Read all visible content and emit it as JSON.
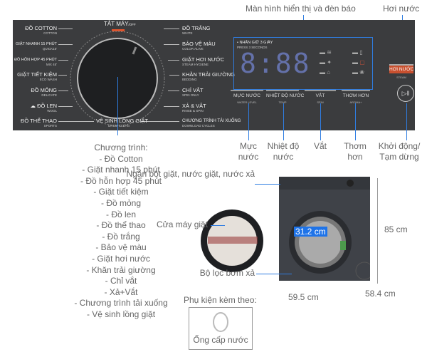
{
  "top_labels": {
    "display": "Màn hình hiển thị và đèn báo",
    "steam": "Hơi nước"
  },
  "panel": {
    "off": "TẮT MÁY",
    "off_en": "/OFF",
    "left_programs": [
      {
        "vi": "ĐỒ COTTON",
        "en": "COTTON"
      },
      {
        "vi": "GIẶT NHANH 15 PHÚT",
        "en": "QUICK15'"
      },
      {
        "vi": "ĐỒ HỖN HỢP 45 PHÚT",
        "en": "MIX 45'"
      },
      {
        "vi": "GIẶT TIẾT KIỆM",
        "en": "ECO WASH"
      },
      {
        "vi": "ĐỒ MỎNG",
        "en": "DELICATE"
      },
      {
        "vi": "ĐỒ LEN",
        "en": "WOOL"
      },
      {
        "vi": "ĐỒ THỂ THAO",
        "en": "SPORTS"
      }
    ],
    "right_programs": [
      {
        "vi": "ĐỒ TRẮNG",
        "en": "WHITE"
      },
      {
        "vi": "BẢO VỆ MÀU",
        "en": "COLOR ALIVE"
      },
      {
        "vi": "GIẶT HƠI NƯỚC",
        "en": "STEAM HYGIENE"
      },
      {
        "vi": "KHĂN TRẢI GIƯỜNG",
        "en": "BEDDING"
      },
      {
        "vi": "CHỈ VẮT",
        "en": "SPIN ONLY"
      },
      {
        "vi": "XẢ & VẮT",
        "en": "RINSE & SPIN"
      },
      {
        "vi": "CHƯƠNG TRÌNH TẢI XUỐNG",
        "en": "DOWNLOAD CYCLES"
      }
    ],
    "bottom_program": {
      "vi": "VỆ SINH LỒNG GIẶT",
      "en": "DRUM CLEAN"
    },
    "display": {
      "hold": "• NHẤN GIỮ 3 GIÂY",
      "hold_en": "PRESS 3 SECONDS",
      "digits": "8:88"
    },
    "buttons": [
      {
        "vi": "MỰC NƯỚC",
        "en": "WATER LEVEL"
      },
      {
        "vi": "NHIỆT ĐỘ NƯỚC",
        "en": "TEMP"
      },
      {
        "vi": "VẮT",
        "en": "SPIN"
      },
      {
        "vi": "THƠM HƠN",
        "en": "AROMA+"
      }
    ],
    "steam_button": {
      "vi": "HƠI NƯỚC",
      "en": "STEAM"
    },
    "accent": "#e0532b"
  },
  "callouts": {
    "water": "Mực nước",
    "temp": "Nhiệt độ nước",
    "spin": "Vắt",
    "aroma": "Thơm hơn",
    "start": "Khởi động/ Tạm dừng"
  },
  "programs_list": {
    "title": "Chương trình:",
    "items": [
      "- Đồ Cotton",
      "- Giặt nhanh 15 phút",
      "- Đồ hỗn hợp 45 phút",
      "- Giặt tiết kiệm",
      "- Đồ mỏng",
      "- Đồ len",
      "- Đồ thể thao",
      "- Đồ trắng",
      "- Bảo vệ màu",
      "- Giặt hơi nước",
      "- Khăn trải giường",
      "- Chỉ vắt",
      "- Xả+Vắt",
      "- Chương trình tải xuống",
      "- Vệ sinh lồng giặt"
    ]
  },
  "machine": {
    "drawer": "Ngăn bột giặt, nước giặt, nước xả",
    "door": "Cửa máy giặt",
    "filter": "Bộ lọc bơm xả",
    "door_diameter": "31.2 cm",
    "height": "85 cm",
    "width": "59.5 cm",
    "depth": "58.4 cm"
  },
  "accessories": {
    "title": "Phụ kiện kèm theo:",
    "item": "Ống cấp nước"
  },
  "colors": {
    "callout_line": "#2f7de1",
    "panel": "#3b3c3e",
    "badge": "#1e73e8"
  }
}
